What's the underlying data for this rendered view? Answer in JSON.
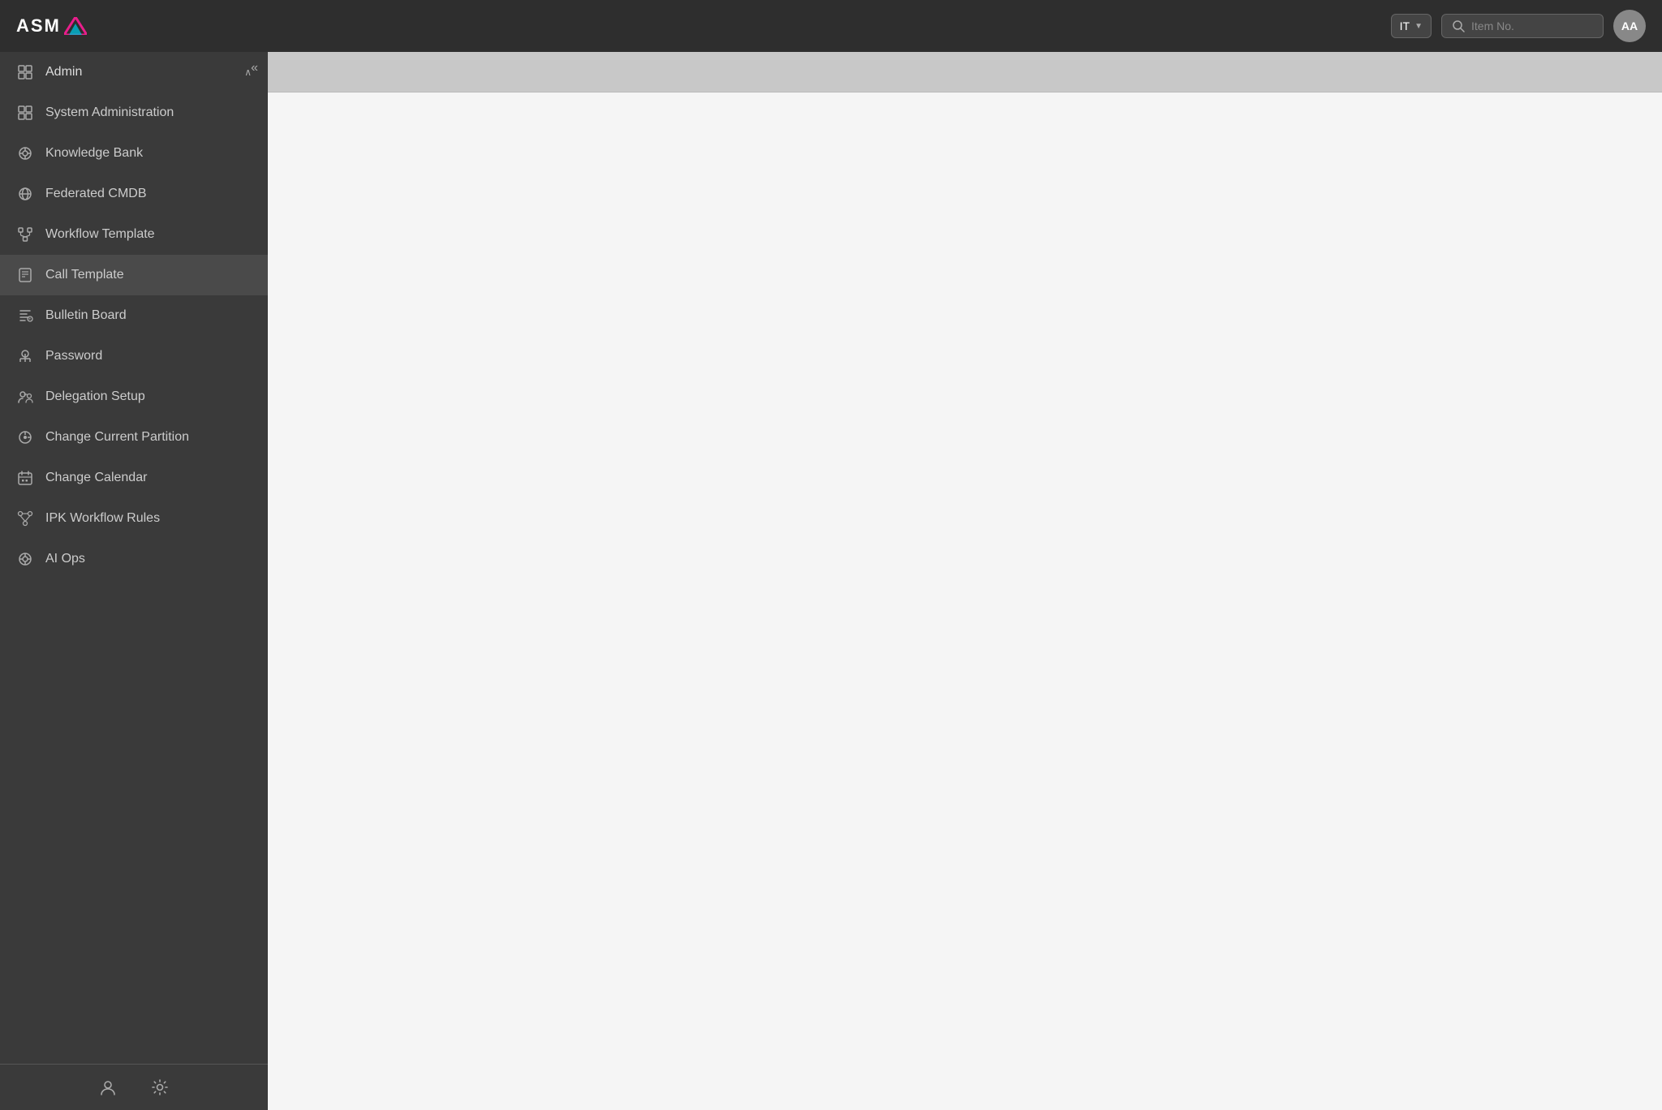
{
  "header": {
    "logo_text": "ASM",
    "partition_label": "IT",
    "search_placeholder": "Item No.",
    "avatar_initials": "AA"
  },
  "sidebar": {
    "collapse_label": "«",
    "group": {
      "icon": "admin-icon",
      "label": "Admin",
      "chevron": "^"
    },
    "items": [
      {
        "id": "system-administration",
        "label": "System Administration",
        "icon": "grid-icon"
      },
      {
        "id": "knowledge-bank",
        "label": "Knowledge Bank",
        "icon": "knowledge-icon"
      },
      {
        "id": "federated-cmdb",
        "label": "Federated CMDB",
        "icon": "cmdb-icon"
      },
      {
        "id": "workflow-template",
        "label": "Workflow Template",
        "icon": "workflow-icon"
      },
      {
        "id": "call-template",
        "label": "Call Template",
        "icon": "call-template-icon"
      },
      {
        "id": "bulletin-board",
        "label": "Bulletin Board",
        "icon": "bulletin-icon"
      },
      {
        "id": "password",
        "label": "Password",
        "icon": "password-icon"
      },
      {
        "id": "delegation-setup",
        "label": "Delegation Setup",
        "icon": "delegation-icon"
      },
      {
        "id": "change-current-partition",
        "label": "Change Current Partition",
        "icon": "partition-icon"
      },
      {
        "id": "change-calendar",
        "label": "Change Calendar",
        "icon": "calendar-icon"
      },
      {
        "id": "ipk-workflow-rules",
        "label": "IPK Workflow Rules",
        "icon": "ipk-icon"
      },
      {
        "id": "ai-ops",
        "label": "AI Ops",
        "icon": "aiops-icon"
      }
    ],
    "bottom_icons": {
      "user_icon": "user-icon",
      "settings_icon": "settings-icon"
    }
  }
}
